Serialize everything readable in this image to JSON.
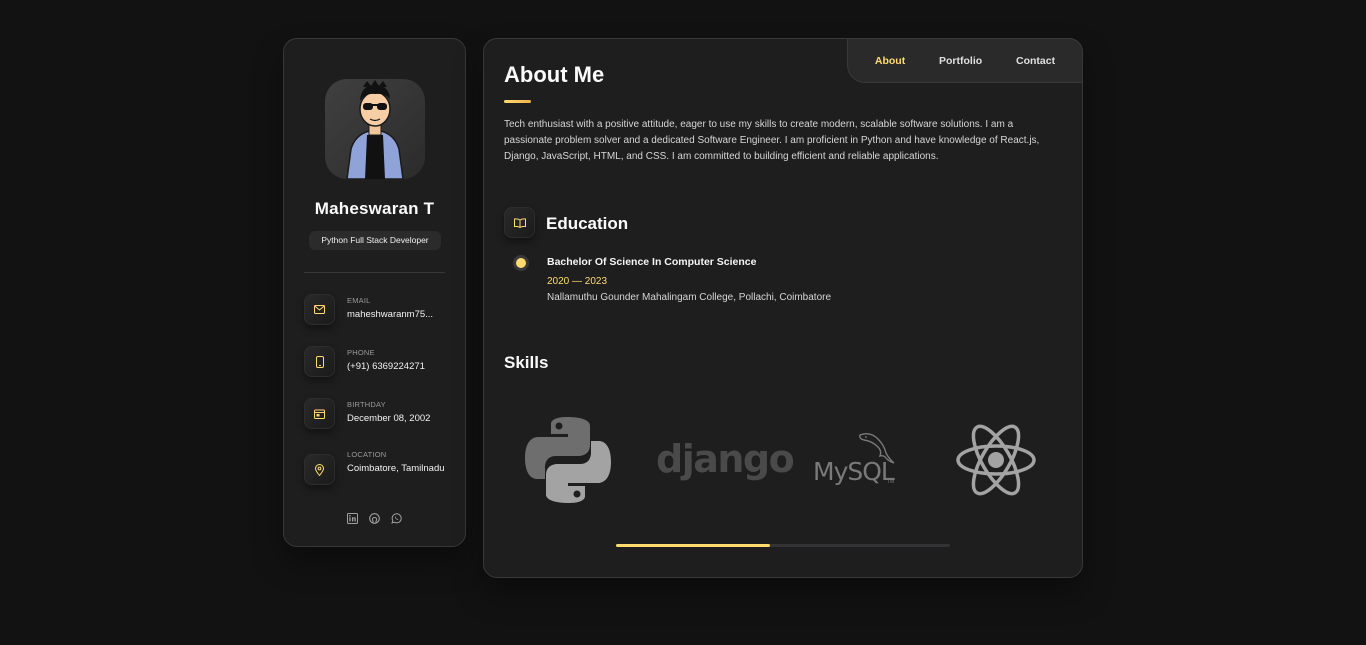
{
  "sidebar": {
    "name": "Maheswaran T",
    "title": "Python Full Stack Developer",
    "contacts": [
      {
        "label": "Email",
        "value": "maheshwaranm75...",
        "icon": "mail-icon"
      },
      {
        "label": "Phone",
        "value": "(+91) 6369224271",
        "icon": "phone-icon"
      },
      {
        "label": "Birthday",
        "value": "December 08, 2002",
        "icon": "calendar-icon"
      },
      {
        "label": "Location",
        "value": "Coimbatore, Tamilnadu",
        "icon": "location-icon"
      }
    ],
    "socials": [
      "linkedin-icon",
      "github-icon",
      "whatsapp-icon"
    ]
  },
  "nav": {
    "items": [
      {
        "label": "About",
        "active": true
      },
      {
        "label": "Portfolio",
        "active": false
      },
      {
        "label": "Contact",
        "active": false
      }
    ]
  },
  "about": {
    "title": "About Me",
    "text": "Tech enthusiast with a positive attitude, eager to use my skills to create modern, scalable software solutions. I am a passionate problem solver and a dedicated Software Engineer. I am proficient in Python and have knowledge of React.js, Django, JavaScript, HTML, and CSS. I am committed to building efficient and reliable applications."
  },
  "education": {
    "title": "Education",
    "items": [
      {
        "degree": "Bachelor Of Science In Computer Science",
        "years": "2020 — 2023",
        "school": "Nallamuthu Gounder Mahalingam College, Pollachi, Coimbatore"
      }
    ]
  },
  "skills": {
    "title": "Skills",
    "logos": [
      {
        "name": "python-logo"
      },
      {
        "name": "django-logo",
        "text": "django"
      },
      {
        "name": "mysql-logo",
        "text": "MySQL",
        "tm": "TM"
      },
      {
        "name": "react-logo"
      }
    ],
    "scroll_progress": 0.46
  },
  "colors": {
    "accent": "#ffdb70",
    "background": "#121212",
    "card": "#1e1e1f"
  }
}
